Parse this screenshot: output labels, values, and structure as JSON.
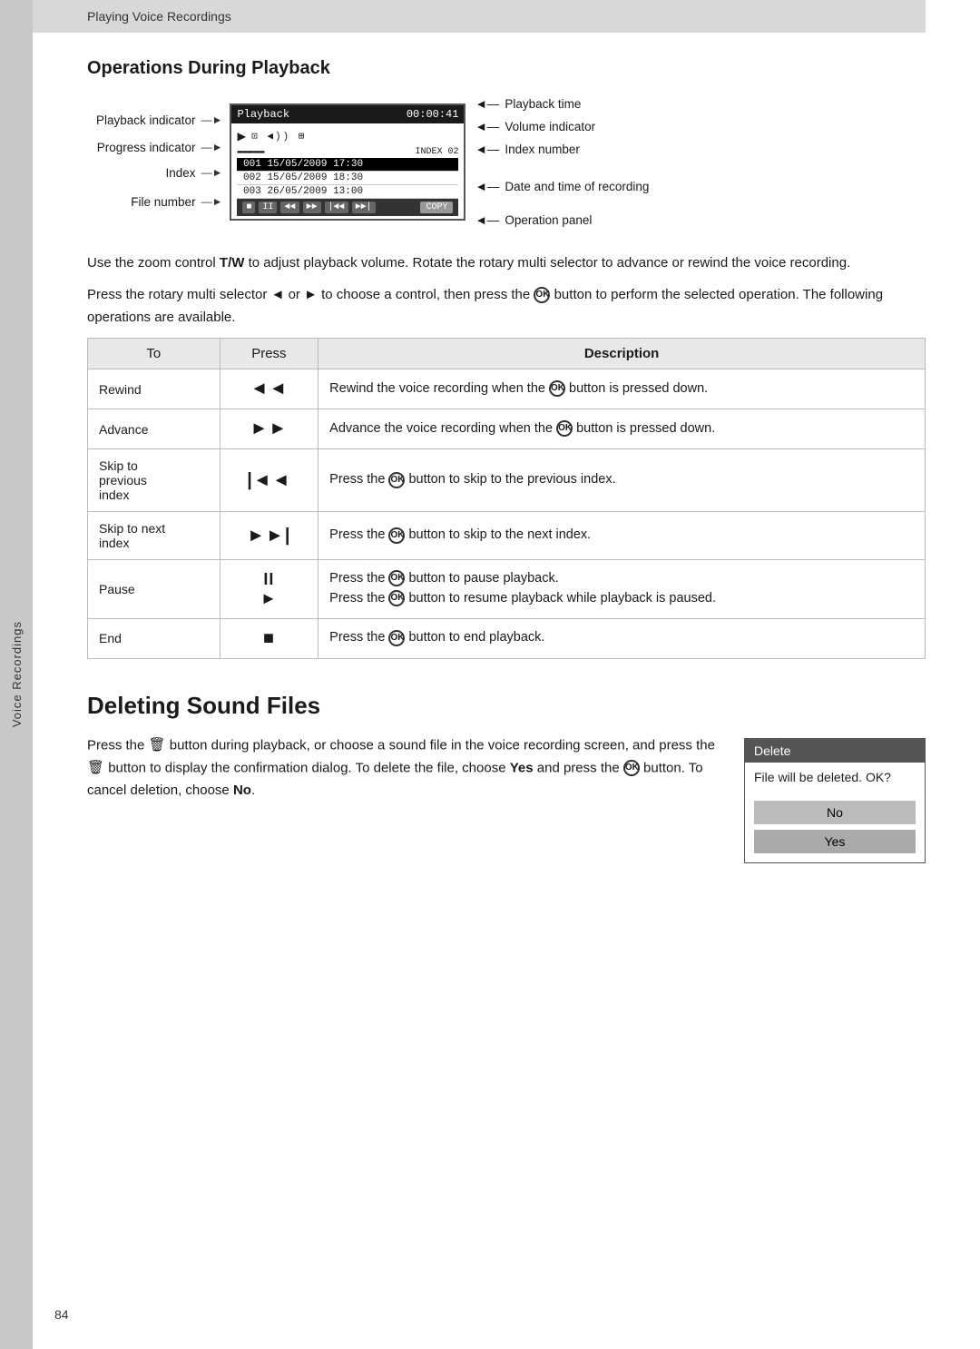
{
  "header": {
    "section": "Playing Voice Recordings"
  },
  "side_tab": {
    "label": "Voice Recordings"
  },
  "page_number": "84",
  "operations_section": {
    "title": "Operations During Playback",
    "diagram": {
      "labels_left": [
        "Playback indicator",
        "Progress indicator",
        "Index",
        "File number"
      ],
      "screen": {
        "header_label": "Playback",
        "header_time": "00:00:41",
        "icon_row": "",
        "index_label": "INDEX 02",
        "file1": "001  15/05/2009  17:30",
        "file2": "002  15/05/2009  18:30",
        "file3": "003  26/05/2009  13:00"
      },
      "labels_right": [
        "Playback time",
        "Volume indicator",
        "Index number",
        "Date and time of recording",
        "Operation panel"
      ]
    },
    "body_text_1": "Use the zoom control T/W to adjust playback volume. Rotate the rotary multi selector to advance or rewind the voice recording.",
    "body_text_2": "Press the rotary multi selector ◄ or ► to choose a control, then press the  button to perform the selected operation. The following operations are available.",
    "table": {
      "headers": [
        "To",
        "Press",
        "Description"
      ],
      "rows": [
        {
          "to": "Rewind",
          "press": "◄◄",
          "description": "Rewind the voice recording when the  button is pressed down."
        },
        {
          "to": "Advance",
          "press": "►►",
          "description": "Advance the voice recording when the  button is pressed down."
        },
        {
          "to": "Skip to\nprevious\nindex",
          "press": "|◄◄",
          "description": "Press the  button to skip to the previous index."
        },
        {
          "to": "Skip to next\nindex",
          "press": "►►|",
          "description": "Press the  button to skip to the next index."
        },
        {
          "to": "Pause",
          "press": "II\n►",
          "description": "Press the  button to pause playback.\nPress the  button to resume playback while playback is paused."
        },
        {
          "to": "End",
          "press": "■",
          "description": "Press the  button to end playback."
        }
      ]
    }
  },
  "deleting_section": {
    "title": "Deleting Sound Files",
    "body_text": "Press the  button during playback, or choose a sound file in the voice recording screen, and press the  button to display the confirmation dialog. To delete the file, choose Yes and press the  button. To cancel deletion, choose No.",
    "dialog": {
      "header": "Delete",
      "message": "File will be deleted. OK?",
      "btn_no": "No",
      "btn_yes": "Yes"
    }
  }
}
